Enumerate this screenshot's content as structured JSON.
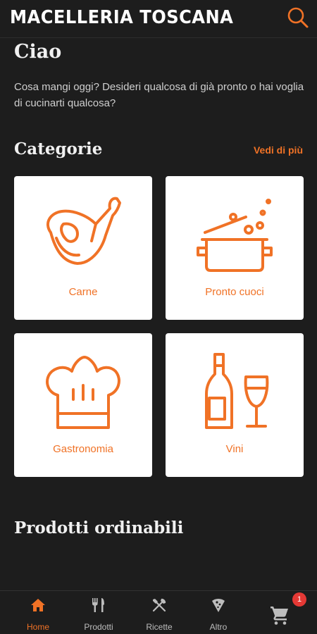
{
  "header": {
    "title": "MACELLERIA TOSCANA",
    "search_icon": "search-icon"
  },
  "greeting": "Ciao",
  "intro_text": "Cosa mangi oggi? Desideri qualcosa di già pronto o hai voglia di cucinarti qualcosa?",
  "categories": {
    "title": "Categorie",
    "see_more": "Vedi di più",
    "items": [
      {
        "label": "Carne",
        "icon": "meat-icon"
      },
      {
        "label": "Pronto cuoci",
        "icon": "pot-icon"
      },
      {
        "label": "Gastronomia",
        "icon": "chef-hat-icon"
      },
      {
        "label": "Vini",
        "icon": "wine-icon"
      }
    ]
  },
  "orderable_title": "Prodotti ordinabili",
  "bottom_nav": {
    "items": [
      {
        "label": "Home",
        "icon": "home-icon",
        "active": true
      },
      {
        "label": "Prodotti",
        "icon": "cutlery-icon",
        "active": false
      },
      {
        "label": "Ricette",
        "icon": "crossed-utensils-icon",
        "active": false
      },
      {
        "label": "Altro",
        "icon": "pizza-slice-icon",
        "active": false
      }
    ],
    "cart_icon": "cart-icon",
    "cart_count": "1"
  },
  "colors": {
    "accent": "#f07226",
    "background": "#1d1d1d",
    "card": "#ffffff",
    "badge": "#e53935"
  }
}
